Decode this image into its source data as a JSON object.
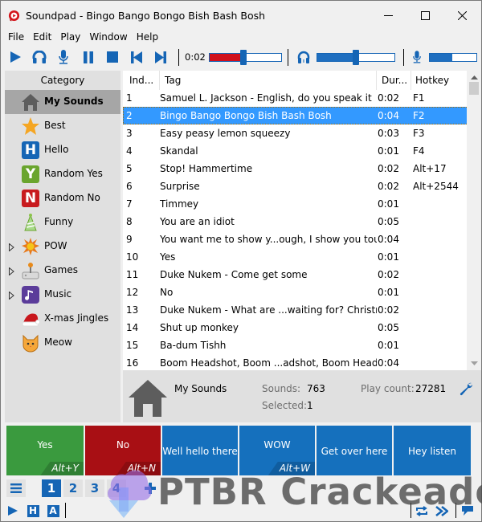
{
  "window": {
    "title": "Soundpad - Bingo Bango Bongo Bish Bash Bosh",
    "minimize_icon": "minimize-icon",
    "maximize_icon": "maximize-icon",
    "close_icon": "close-icon"
  },
  "menu": [
    "File",
    "Edit",
    "Play",
    "Window",
    "Help"
  ],
  "toolbar": {
    "buttons": [
      "play-icon",
      "headphones-icon",
      "microphone-icon",
      "pause-icon",
      "stop-icon",
      "previous-icon",
      "next-icon"
    ],
    "time": "0:02",
    "playback_progress_percent": 47,
    "headphone_volume_percent": 50,
    "microphone_volume_percent": 48,
    "accent_color": "#1565b5",
    "progress_color": "#d0101c"
  },
  "sidebar": {
    "header": "Category",
    "items": [
      {
        "label": "My Sounds",
        "icon": "house-icon",
        "selected": true,
        "expandable": false
      },
      {
        "label": "Best",
        "icon": "star-icon",
        "selected": false,
        "expandable": false
      },
      {
        "label": "Hello",
        "icon": "letter-h-icon",
        "letter": "H",
        "color": "#1565b5",
        "selected": false,
        "expandable": false
      },
      {
        "label": "Random Yes",
        "icon": "letter-y-icon",
        "letter": "Y",
        "color": "#6aa52e",
        "selected": false,
        "expandable": false
      },
      {
        "label": "Random No",
        "icon": "letter-n-icon",
        "letter": "N",
        "color": "#c81a1e",
        "selected": false,
        "expandable": false
      },
      {
        "label": "Funny",
        "icon": "party-hat-icon",
        "selected": false,
        "expandable": false
      },
      {
        "label": "POW",
        "icon": "explosion-icon",
        "selected": false,
        "expandable": true
      },
      {
        "label": "Games",
        "icon": "joystick-icon",
        "selected": false,
        "expandable": true
      },
      {
        "label": "Music",
        "icon": "music-note-icon",
        "selected": false,
        "expandable": true
      },
      {
        "label": "X-mas Jingles",
        "icon": "santa-hat-icon",
        "selected": false,
        "expandable": false
      },
      {
        "label": "Meow",
        "icon": "cat-icon",
        "selected": false,
        "expandable": false
      }
    ]
  },
  "list": {
    "columns": [
      "Ind...",
      "Tag",
      "Dur...",
      "Hotkey"
    ],
    "rows": [
      {
        "index": "1",
        "tag": "Samuel L. Jackson - English, do you speak it",
        "duration": "0:02",
        "hotkey": "F1"
      },
      {
        "index": "2",
        "tag": "Bingo Bango Bongo Bish Bash Bosh",
        "duration": "0:04",
        "hotkey": "F2",
        "selected": true
      },
      {
        "index": "3",
        "tag": "Easy peasy lemon squeezy",
        "duration": "0:03",
        "hotkey": "F3"
      },
      {
        "index": "4",
        "tag": "Skandal",
        "duration": "0:01",
        "hotkey": "F4"
      },
      {
        "index": "5",
        "tag": "Stop! Hammertime",
        "duration": "0:02",
        "hotkey": "Alt+17"
      },
      {
        "index": "6",
        "tag": "Surprise",
        "duration": "0:02",
        "hotkey": "Alt+2544"
      },
      {
        "index": "7",
        "tag": "Timmey",
        "duration": "0:01",
        "hotkey": ""
      },
      {
        "index": "8",
        "tag": "You are an idiot",
        "duration": "0:05",
        "hotkey": ""
      },
      {
        "index": "9",
        "tag": "You want me to show y...ough, I show you tough",
        "duration": "0:04",
        "hotkey": ""
      },
      {
        "index": "10",
        "tag": "Yes",
        "duration": "0:01",
        "hotkey": ""
      },
      {
        "index": "11",
        "tag": "Duke Nukem - Come get some",
        "duration": "0:02",
        "hotkey": ""
      },
      {
        "index": "12",
        "tag": "No",
        "duration": "0:01",
        "hotkey": ""
      },
      {
        "index": "13",
        "tag": "Duke Nukem - What are ...waiting for? Christmas?",
        "duration": "0:02",
        "hotkey": ""
      },
      {
        "index": "14",
        "tag": "Shut up monkey",
        "duration": "0:05",
        "hotkey": ""
      },
      {
        "index": "15",
        "tag": "Ba-dum Tishh",
        "duration": "0:01",
        "hotkey": ""
      },
      {
        "index": "16",
        "tag": "Boom Headshot, Boom ...adshot, Boom Headshot",
        "duration": "0:04",
        "hotkey": ""
      }
    ],
    "selection_color": "#3399ff"
  },
  "info": {
    "name": "My Sounds",
    "sounds_label": "Sounds:",
    "sounds_value": "763",
    "selected_label": "Selected:",
    "selected_value": "1",
    "playcount_label": "Play count:",
    "playcount_value": "27281",
    "settings_icon": "wrench-icon"
  },
  "pads": [
    {
      "label": "Yes",
      "hotkey": "Alt+Y",
      "color": "#3a9a3e",
      "hotkey_bg": "#2f7f33"
    },
    {
      "label": "No",
      "hotkey": "Alt+N",
      "color": "#a80f14",
      "hotkey_bg": "#8c0c10"
    },
    {
      "label": "Well hello there",
      "hotkey": "",
      "color": "#1570bd"
    },
    {
      "label": "WOW",
      "hotkey": "Alt+W",
      "color": "#1570bd",
      "hotkey_bg": "#105d9f"
    },
    {
      "label": "Get over here",
      "hotkey": "",
      "color": "#1570bd"
    },
    {
      "label": "Hey listen",
      "hotkey": "",
      "color": "#1570bd"
    }
  ],
  "tabs": {
    "menu_icon": "hamburger-menu-icon",
    "pages": [
      "1",
      "2",
      "3",
      "4"
    ],
    "active_page": "1",
    "add_icon": "plus-icon"
  },
  "statusbar": {
    "left_icons": [
      "play-icon",
      "letter-h-icon",
      "letter-a-icon"
    ],
    "h_label": "H",
    "a_label": "A",
    "right_icons": [
      "repeat-icon",
      "fast-forward-icon",
      "speech-bubble-icon"
    ]
  },
  "watermark": {
    "text": "PTBR Crackeado"
  }
}
